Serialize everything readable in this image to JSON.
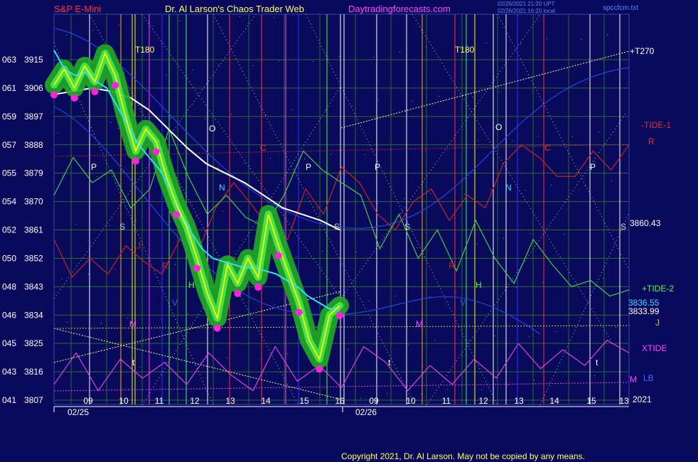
{
  "header": {
    "instrument": "S&P E-Mini",
    "author": "Dr. Al Larson's Chaos Trader Web",
    "site": "Daytradingforecasts.com",
    "stamp1": "02/26/2021 21:20 UPT",
    "stamp2": "02/26/2021 16:20 local",
    "file": "spccfcm.txt"
  },
  "copyright": "Copyright 2021, Dr. Al Larson. May not be copied by any means.",
  "colors": {
    "background": "#0a0a5c",
    "price": "#ffff00",
    "price_glow": "#22aa22",
    "dots": "#ff22dd",
    "ma_fast": "#33ddff",
    "ma_slow": "#ffffff",
    "tide1": "#cc2222",
    "tide2": "#44cc44",
    "xtide": "#dd44dd",
    "ref_line": "#ffff88"
  },
  "chart_data": {
    "type": "line",
    "title": "S&P E-Mini",
    "ylim": [
      3807,
      3920
    ],
    "y_tick_labels": [
      {
        "left": "063",
        "price": "3915"
      },
      {
        "left": "061",
        "price": "3906"
      },
      {
        "left": "059",
        "price": "3897"
      },
      {
        "left": "057",
        "price": "3888"
      },
      {
        "left": "055",
        "price": "3879"
      },
      {
        "left": "054",
        "price": "3870"
      },
      {
        "left": "052",
        "price": "3861"
      },
      {
        "left": "050",
        "price": "3852"
      },
      {
        "left": "048",
        "price": "3843"
      },
      {
        "left": "046",
        "price": "3834"
      },
      {
        "left": "045",
        "price": "3825"
      },
      {
        "left": "043",
        "price": "3816"
      },
      {
        "left": "041",
        "price": "3807"
      }
    ],
    "x_hour_labels": [
      "09",
      "10",
      "11",
      "12",
      "13",
      "14",
      "15",
      "16",
      "09",
      "10",
      "11",
      "12",
      "13",
      "14",
      "15",
      "13"
    ],
    "date_labels": [
      "02/25",
      "02/26"
    ],
    "series": [
      {
        "name": "price",
        "values": [
          3907,
          3912,
          3906,
          3913,
          3908,
          3917,
          3910,
          3897,
          3886,
          3893,
          3889,
          3878,
          3869,
          3862,
          3852,
          3841,
          3833,
          3850,
          3844,
          3852,
          3846,
          3866,
          3856,
          3847,
          3838,
          3826,
          3820,
          3834,
          3837
        ]
      },
      {
        "name": "fast_ma",
        "values": [
          3918,
          3912,
          3910,
          3911,
          3908,
          3906,
          3900,
          3894,
          3888,
          3884,
          3880,
          3874,
          3866,
          3860,
          3855,
          3852,
          3851,
          3850,
          3849,
          3849,
          3848,
          3847,
          3845,
          3843,
          3840,
          3838,
          3836,
          3836
        ]
      },
      {
        "name": "slow_ma",
        "values": [
          3904,
          3905,
          3906,
          3905,
          3903,
          3899,
          3893,
          3887,
          3882,
          3879,
          3876,
          3872,
          3868,
          3866,
          3864,
          3861
        ]
      },
      {
        "name": "-TIDE-1",
        "values": [
          3858,
          3846,
          3852,
          3847,
          3856,
          3851,
          3847,
          3858,
          3854,
          3868,
          3876,
          3869,
          3861,
          3858,
          3874,
          3866,
          3881,
          3876,
          3866,
          3861,
          3870,
          3874,
          3864,
          3872,
          3868,
          3882,
          3888,
          3884,
          3878,
          3878,
          3886,
          3880,
          3888
        ]
      },
      {
        "name": "+TIDE-2",
        "values": [
          3872,
          3884,
          3876,
          3880,
          3868,
          3874,
          3893,
          3878,
          3866,
          3872,
          3865,
          3862,
          3872,
          3886,
          3880,
          3876,
          3872,
          3855,
          3866,
          3852,
          3861,
          3848,
          3864,
          3852,
          3844,
          3858,
          3850,
          3843,
          3845,
          3840,
          3842
        ]
      },
      {
        "name": "XTIDE",
        "values": [
          3812,
          3822,
          3810,
          3820,
          3814,
          3819,
          3812,
          3822,
          3815,
          3810,
          3824,
          3813,
          3818,
          3811,
          3824,
          3819,
          3810,
          3818,
          3812,
          3820,
          3814,
          3825,
          3817,
          3823,
          3818,
          3826,
          3822
        ]
      }
    ],
    "right_labels": {
      "t270": "+T270",
      "tide1": "-TIDE-1",
      "r": "R",
      "price_3860": "3860.43",
      "tide2": "+TIDE-2",
      "price_3836": "3836.55",
      "price_3833": "3833.99",
      "j": "J",
      "xtide": "XTIDE",
      "lb": "LB",
      "m": "M",
      "year": "2021"
    },
    "annotations": [
      "T180",
      "T180",
      "O",
      "O",
      "N",
      "N",
      "P",
      "P",
      "P",
      "P",
      "C",
      "C",
      "S",
      "S",
      "S",
      "S",
      "J",
      "R",
      "R",
      "H",
      "H",
      "V",
      "V",
      "M",
      "M",
      "t",
      "t",
      "t"
    ]
  }
}
